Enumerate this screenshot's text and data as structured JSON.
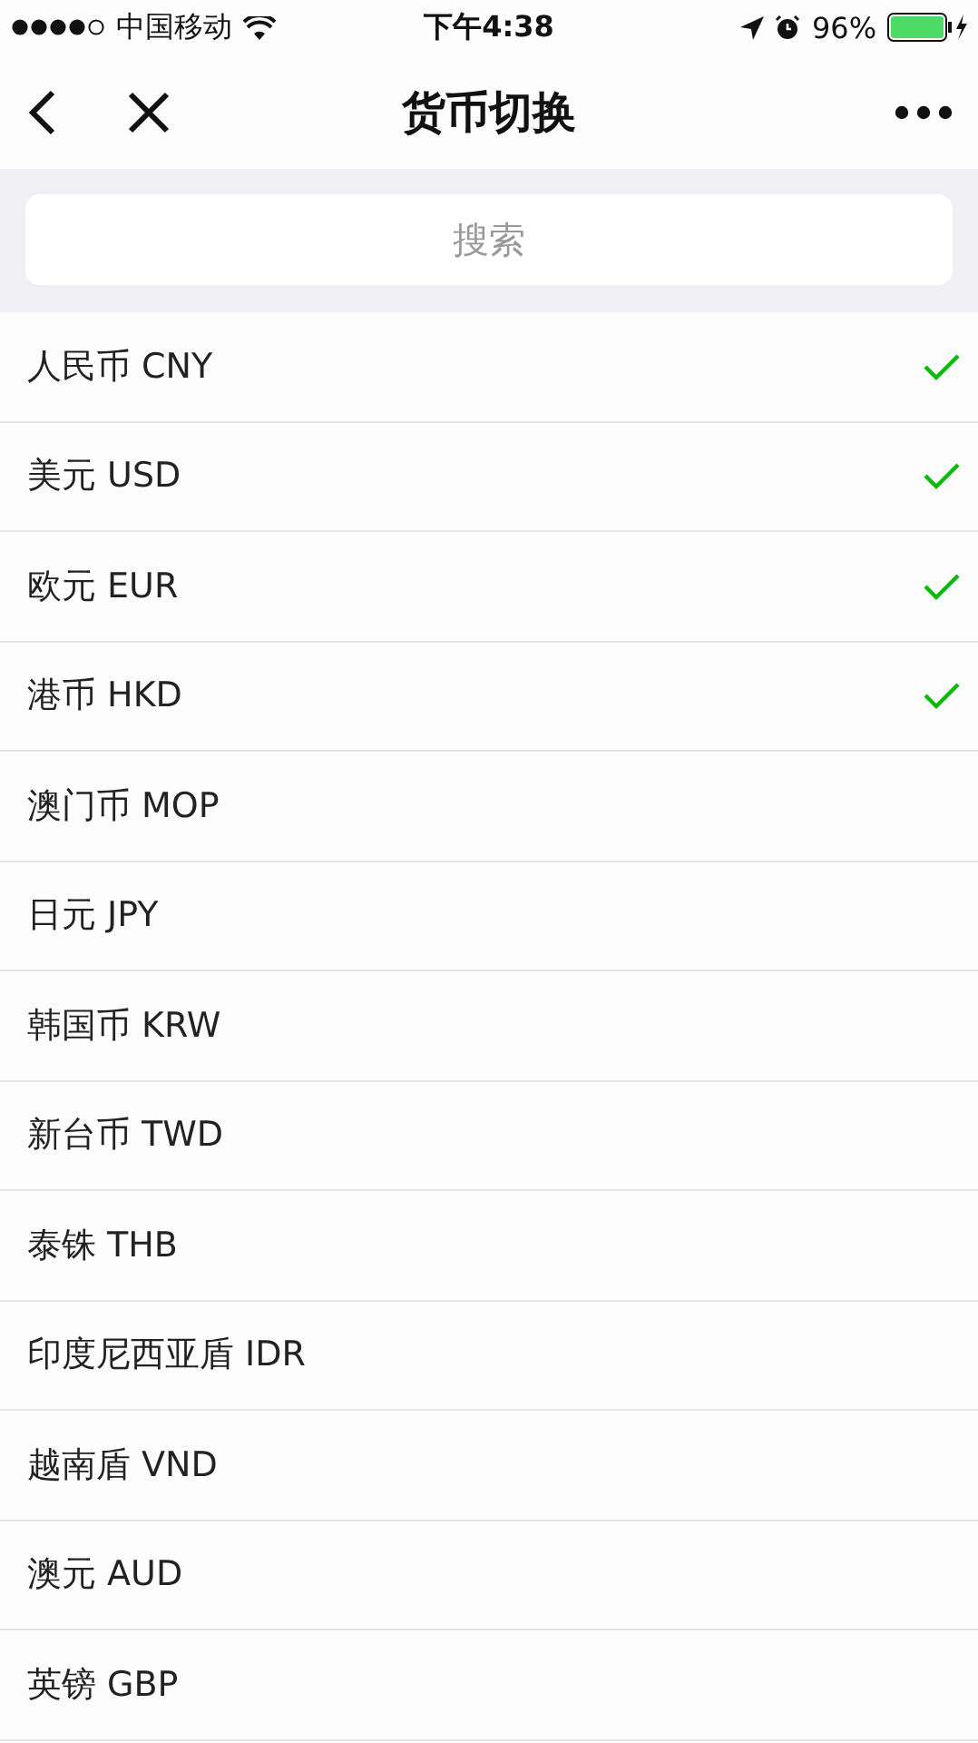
{
  "status_bar": {
    "carrier": "中国移动",
    "time": "下午4:38",
    "battery": "96%"
  },
  "nav_bar": {
    "title": "货币切换"
  },
  "search": {
    "placeholder": "搜索"
  },
  "currencies": [
    {
      "label": "人民币 CNY",
      "checked": true
    },
    {
      "label": "美元 USD",
      "checked": true
    },
    {
      "label": "欧元 EUR",
      "checked": true
    },
    {
      "label": "港币 HKD",
      "checked": true
    },
    {
      "label": "澳门币 MOP",
      "checked": false
    },
    {
      "label": "日元 JPY",
      "checked": false
    },
    {
      "label": "韩国币 KRW",
      "checked": false
    },
    {
      "label": "新台币 TWD",
      "checked": false
    },
    {
      "label": "泰铢 THB",
      "checked": false
    },
    {
      "label": "印度尼西亚盾 IDR",
      "checked": false
    },
    {
      "label": "越南盾 VND",
      "checked": false
    },
    {
      "label": "澳元 AUD",
      "checked": false
    },
    {
      "label": "英镑 GBP",
      "checked": false
    }
  ]
}
